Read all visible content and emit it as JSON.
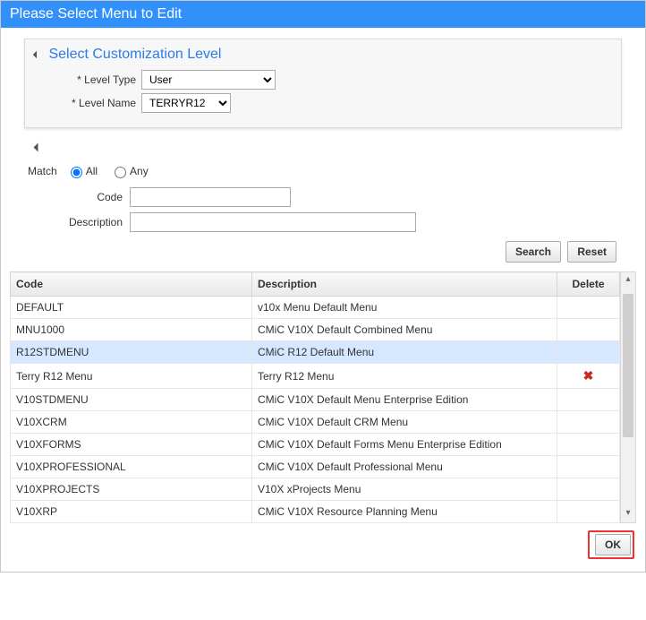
{
  "dialog": {
    "title": "Please Select Menu to Edit"
  },
  "panel": {
    "header": "Select Customization Level",
    "level_type_label": "Level Type",
    "level_type_value": "User",
    "level_name_label": "Level Name",
    "level_name_value": "TERRYR12"
  },
  "search": {
    "match_label": "Match",
    "all_label": "All",
    "any_label": "Any",
    "code_label": "Code",
    "description_label": "Description",
    "code_value": "",
    "description_value": "",
    "search_btn": "Search",
    "reset_btn": "Reset"
  },
  "grid": {
    "headers": {
      "code": "Code",
      "description": "Description",
      "delete": "Delete"
    },
    "rows": [
      {
        "code": "DEFAULT",
        "description": "v10x Menu Default Menu",
        "deletable": false,
        "selected": false
      },
      {
        "code": "MNU1000",
        "description": "CMiC V10X Default Combined Menu",
        "deletable": false,
        "selected": false
      },
      {
        "code": "R12STDMENU",
        "description": "CMiC R12 Default Menu",
        "deletable": false,
        "selected": true
      },
      {
        "code": "Terry R12 Menu",
        "description": "Terry R12 Menu",
        "deletable": true,
        "selected": false
      },
      {
        "code": "V10STDMENU",
        "description": "CMiC V10X Default Menu Enterprise Edition",
        "deletable": false,
        "selected": false
      },
      {
        "code": "V10XCRM",
        "description": "CMiC V10X Default CRM Menu",
        "deletable": false,
        "selected": false
      },
      {
        "code": "V10XFORMS",
        "description": "CMiC V10X Default Forms Menu Enterprise Edition",
        "deletable": false,
        "selected": false
      },
      {
        "code": "V10XPROFESSIONAL",
        "description": "CMiC V10X Default Professional Menu",
        "deletable": false,
        "selected": false
      },
      {
        "code": "V10XPROJECTS",
        "description": "V10X xProjects Menu",
        "deletable": false,
        "selected": false
      },
      {
        "code": "V10XRP",
        "description": "CMiC V10X Resource Planning Menu",
        "deletable": false,
        "selected": false
      }
    ]
  },
  "footer": {
    "ok": "OK"
  }
}
